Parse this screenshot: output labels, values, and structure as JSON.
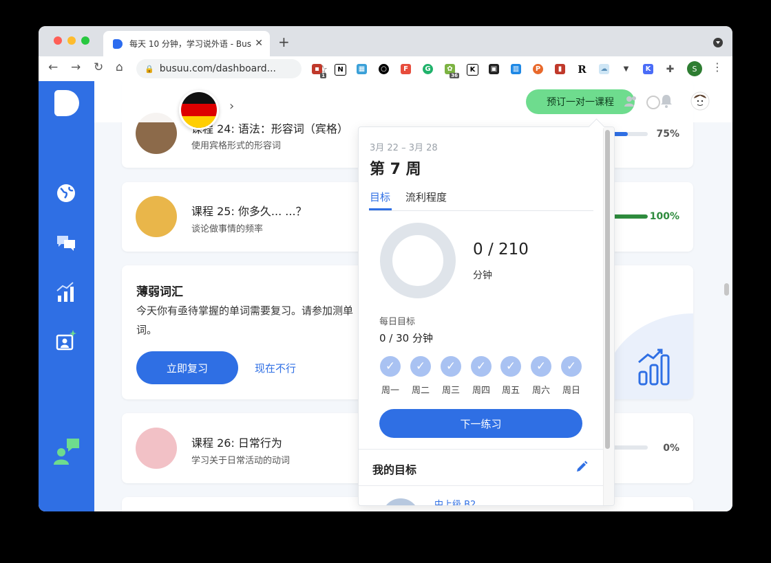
{
  "browser": {
    "tab_title": "每天 10 分钟，学习说外语 - Bus",
    "tab_close": "✕",
    "new_tab": "+",
    "url": "busuu.com/dashboard...",
    "profile_initial": "S",
    "extension_badges": [
      "1",
      "36"
    ]
  },
  "header": {
    "book_button": "预订一对一课程",
    "flag": "german-flag"
  },
  "lessons": [
    {
      "title": "课程 24: 语法：形容词（宾格）",
      "subtitle": "使用宾格形式的形容词",
      "progress_label": "75%",
      "progress": 0.75,
      "color": "#2f6fe4"
    },
    {
      "title": "课程 25: 你多久... ...？",
      "subtitle": "谈论做事情的频率",
      "progress_label": "100%",
      "progress": 1.0,
      "color": "#2e8b3d"
    },
    {
      "title": "课程 26: 日常行为",
      "subtitle": "学习关于日常活动的动词",
      "progress_label": "0%",
      "progress": 0.0,
      "color": "#2f6fe4"
    }
  ],
  "weak_vocab": {
    "title": "薄弱词汇",
    "body": "今天你有亟待掌握的单词需要复习。请参加测单词。",
    "review_button": "立即复习",
    "not_now": "现在不行"
  },
  "popup": {
    "date_range": "3月 22 – 3月 28",
    "week": "第 7 周",
    "tabs": [
      "目标",
      "流利程度"
    ],
    "minutes_value": "0 / 210",
    "minutes_unit": "分钟",
    "progress": 0,
    "daily_goal_label": "每日目标",
    "daily_goal_value": "0 / 30 分钟",
    "days": [
      "周一",
      "周二",
      "周三",
      "周四",
      "周五",
      "周六",
      "周日"
    ],
    "next_button": "下一练习",
    "my_goals": "我的目标",
    "goal_item": "中上级 B2"
  },
  "colors": {
    "brand_blue": "#2f6fe4",
    "green": "#6edc8e",
    "success": "#2e8b3d"
  }
}
